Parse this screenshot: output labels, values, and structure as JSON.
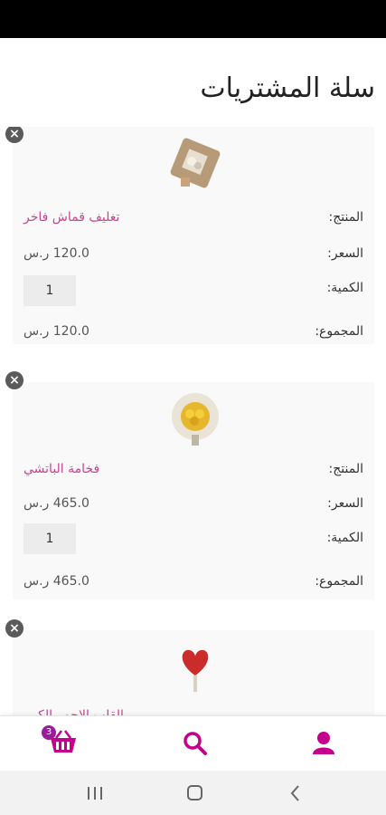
{
  "page": {
    "title": "سلة المشتريات"
  },
  "labels": {
    "product": "المنتج:",
    "price": "السعر:",
    "quantity": "الكمية:",
    "total": "المجموع:"
  },
  "items": [
    {
      "name": "تغليف قماش فاخر",
      "price": "120.0 ر.س",
      "quantity": "1",
      "total": "120.0 ر.س",
      "image": "fabric-wrap-bouquet"
    },
    {
      "name": "فخامة الباتشي",
      "price": "465.0 ر.س",
      "quantity": "1",
      "total": "465.0 ر.س",
      "image": "yellow-flower-bouquet"
    },
    {
      "name": "القلب الاحمر الكبير",
      "image": "red-heart-bouquet"
    }
  ],
  "nav": {
    "cart_count": "3",
    "cart_icon": "cart-icon",
    "search_icon": "search-icon",
    "account_icon": "user-icon"
  },
  "colors": {
    "accent": "#c4008c",
    "product_text": "#c4458f",
    "badge": "#9b1c9b"
  }
}
